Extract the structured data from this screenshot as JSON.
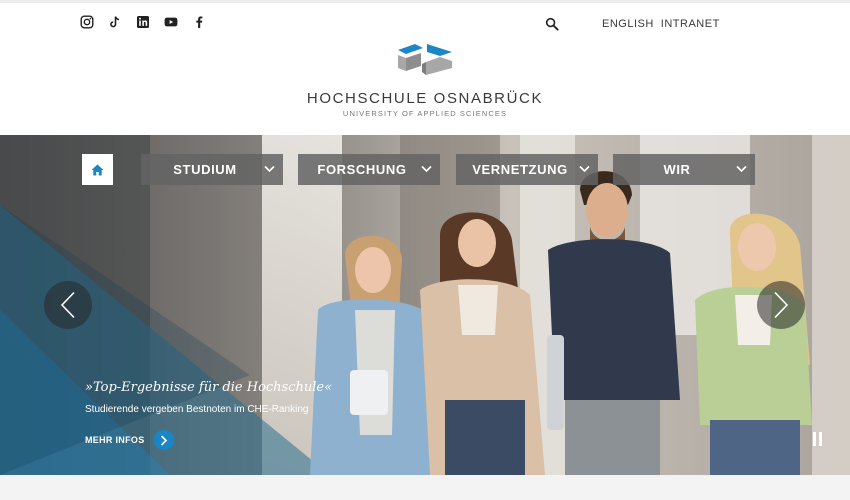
{
  "header": {
    "social_icons": [
      "instagram-icon",
      "tiktok-icon",
      "linkedin-icon",
      "youtube-icon",
      "facebook-icon"
    ],
    "search_icon": "search-icon",
    "links": {
      "english": "ENGLISH",
      "intranet": "INTRANET"
    },
    "brand": {
      "name": "HOCHSCHULE OSNABRÜCK",
      "subtitle": "UNIVERSITY OF APPLIED SCIENCES"
    }
  },
  "nav": {
    "home_icon": "home-icon",
    "items": [
      {
        "label": "STUDIUM"
      },
      {
        "label": "FORSCHUNG"
      },
      {
        "label": "VERNETZUNG"
      },
      {
        "label": "WIR"
      }
    ]
  },
  "slider": {
    "title": "»Top-Ergebnisse für die Hochschule«",
    "subtitle": "Studierende vergeben Bestnoten im CHE-Ranking",
    "more_label": "MEHR INFOS",
    "prev_icon": "chevron-left-icon",
    "next_icon": "chevron-right-icon",
    "pause_icon": "pause-icon"
  },
  "colors": {
    "accent": "#1a86c7",
    "logo_blue": "#1b87c9",
    "nav_bg": "#646464",
    "text": "#3a3a3a"
  }
}
